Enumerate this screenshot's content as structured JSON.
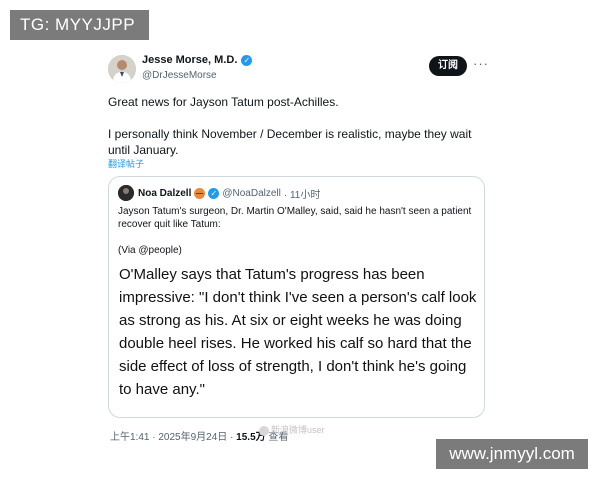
{
  "watermarks": {
    "telegram": "TG: MYYJJPP",
    "site": "www.jnmyyl.com",
    "weibo": "新浪微博user"
  },
  "tweet": {
    "author_name": "Jesse Morse, M.D.",
    "author_handle": "@DrJesseMorse",
    "subscribe_label": "订阅",
    "more_icon": "more-horizontal-icon",
    "body": [
      "Great news for Jayson Tatum post-Achilles.",
      "I personally think November / December is realistic, maybe they wait until January."
    ],
    "translate_label": "翻译帖子",
    "footer": {
      "time": "上午1:41 · 2025年9月24日 · ",
      "views_count": "15.5万",
      "views_label": " 查看"
    }
  },
  "quote": {
    "author_name": "Noa Dalzell",
    "author_handle": "@NoaDalzell",
    "time": "· 11小时",
    "text": "Jayson Tatum's surgeon, Dr. Martin O'Malley, said, said he hasn't seen a patient recover quit like Tatum:",
    "via": "(Via @people)",
    "card_text": "O'Malley says that Tatum's progress has been impressive: \"I don't think I've seen a person's calf look as strong as his. At six or eight weeks he was doing double heel rises. He worked his calf so hard that the side effect of loss of strength, I don't think he's going to have any.\""
  },
  "colors": {
    "verified": "#1d9bf0",
    "text_primary": "#0f1419",
    "text_secondary": "#536471",
    "button_bg": "#0f1419",
    "watermark_bg": "#7b7b7b"
  }
}
